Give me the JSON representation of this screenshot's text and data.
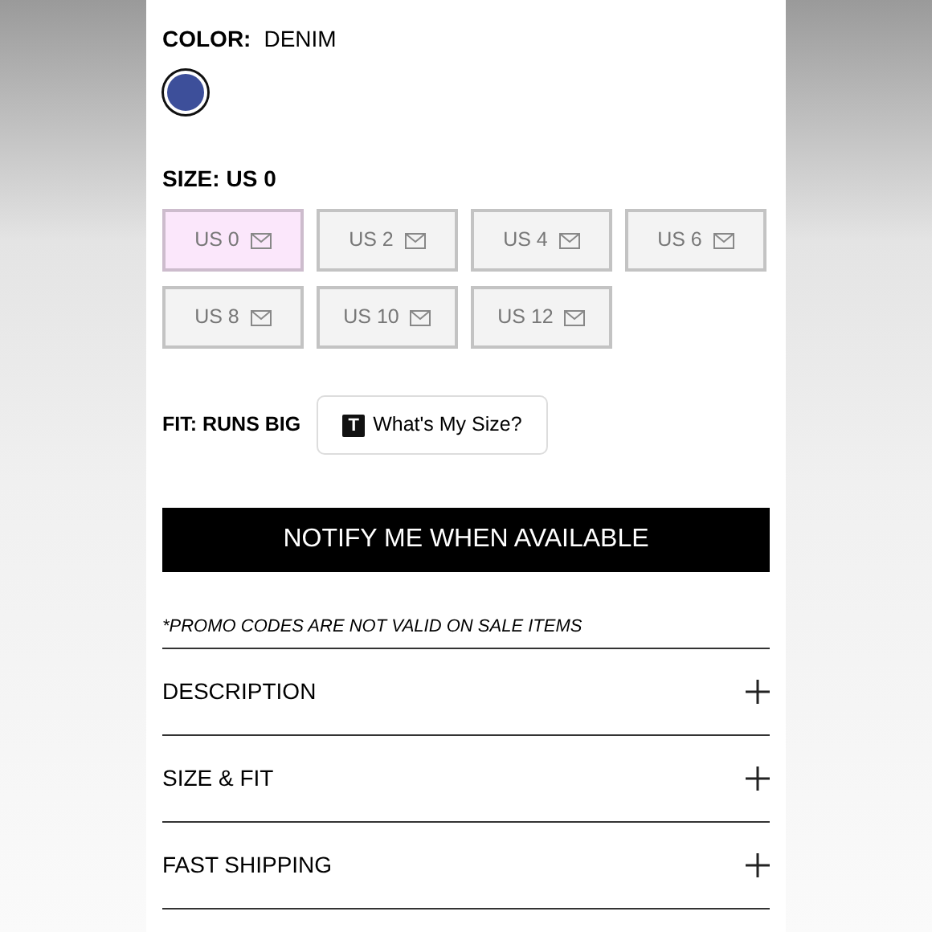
{
  "color": {
    "label": "COLOR:",
    "value": "DENIM",
    "swatches": [
      {
        "color": "#3d4f9a",
        "selected": true
      }
    ]
  },
  "size": {
    "label": "SIZE:",
    "value": "US 0",
    "options": [
      {
        "label": "US 0",
        "selected": true
      },
      {
        "label": "US 2",
        "selected": false
      },
      {
        "label": "US 4",
        "selected": false
      },
      {
        "label": "US 6",
        "selected": false
      },
      {
        "label": "US 8",
        "selected": false
      },
      {
        "label": "US 10",
        "selected": false
      },
      {
        "label": "US 12",
        "selected": false
      }
    ]
  },
  "fit": {
    "label": "FIT: RUNS BIG",
    "size_button": {
      "icon_letter": "T",
      "label": "What's My Size?"
    }
  },
  "notify_button": "NOTIFY ME WHEN AVAILABLE",
  "promo_note": "*PROMO CODES ARE NOT VALID ON SALE ITEMS",
  "sections": [
    {
      "title": "DESCRIPTION",
      "expanded": false
    },
    {
      "title": "SIZE & FIT",
      "expanded": false
    },
    {
      "title": "FAST SHIPPING",
      "expanded": false
    }
  ]
}
